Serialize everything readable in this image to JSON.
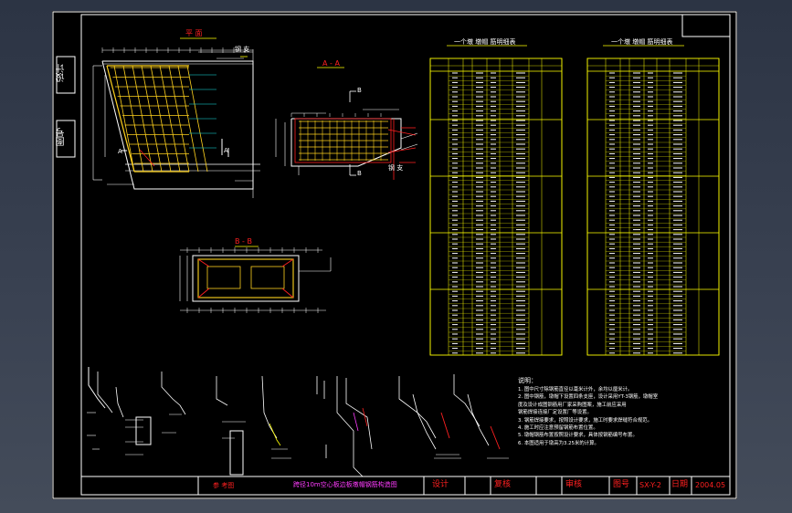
{
  "side_labels": {
    "design": "设计",
    "drawing_no": "图号"
  },
  "views": {
    "plan": {
      "title": "平 面",
      "pier_label": "钢 支",
      "section_mark": "A"
    },
    "section_aa": {
      "title": "A - A",
      "section_mark": "B",
      "pier_label": "钢 支"
    },
    "section_bb": {
      "title": "B - B"
    }
  },
  "tables": {
    "left_title": "一个墩 墩帽 筋明细表",
    "right_title": "一个墩 墩帽 筋明细表"
  },
  "notes": {
    "heading": "说明：",
    "items": [
      "1. 图中尺寸除钢筋直径以毫米计外，余均以厘米计。",
      "2. 图中钢筋，墩帽下设置四条支座，设计采用YT-3钢筋，墩帽室",
      "   度及设计成图钢筋用厂家采购图案，施工前应采用",
      "   钢筋焊接连接厂定设置厂等设置。",
      "3. 钢筋焊接要求，按照设计要求，施工时要求焊缝符合规范。",
      "4. 施工时应注意预留钢筋布置位置。",
      "5. 墩帽钢筋布置按照设计要求，具体按钢筋编号布置。",
      "6. 本图适用于墩高为3.25米的计算。"
    ]
  },
  "title_block": {
    "stamp": "参 考图",
    "title": "跨径10m空心板边板墩帽钢筋构造图",
    "design": "设计",
    "check": "复核",
    "review": "审核",
    "drawing_no_label": "图号",
    "drawing_no": "SX-Y-2",
    "date_label": "日期",
    "date": "2004.05"
  },
  "colors": {
    "line": "#ffffff",
    "rebar": "#ffd21e",
    "grid": "#ffff00",
    "red": "#ff2020",
    "cyan": "#19e6e6",
    "magenta": "#ff3cff"
  }
}
